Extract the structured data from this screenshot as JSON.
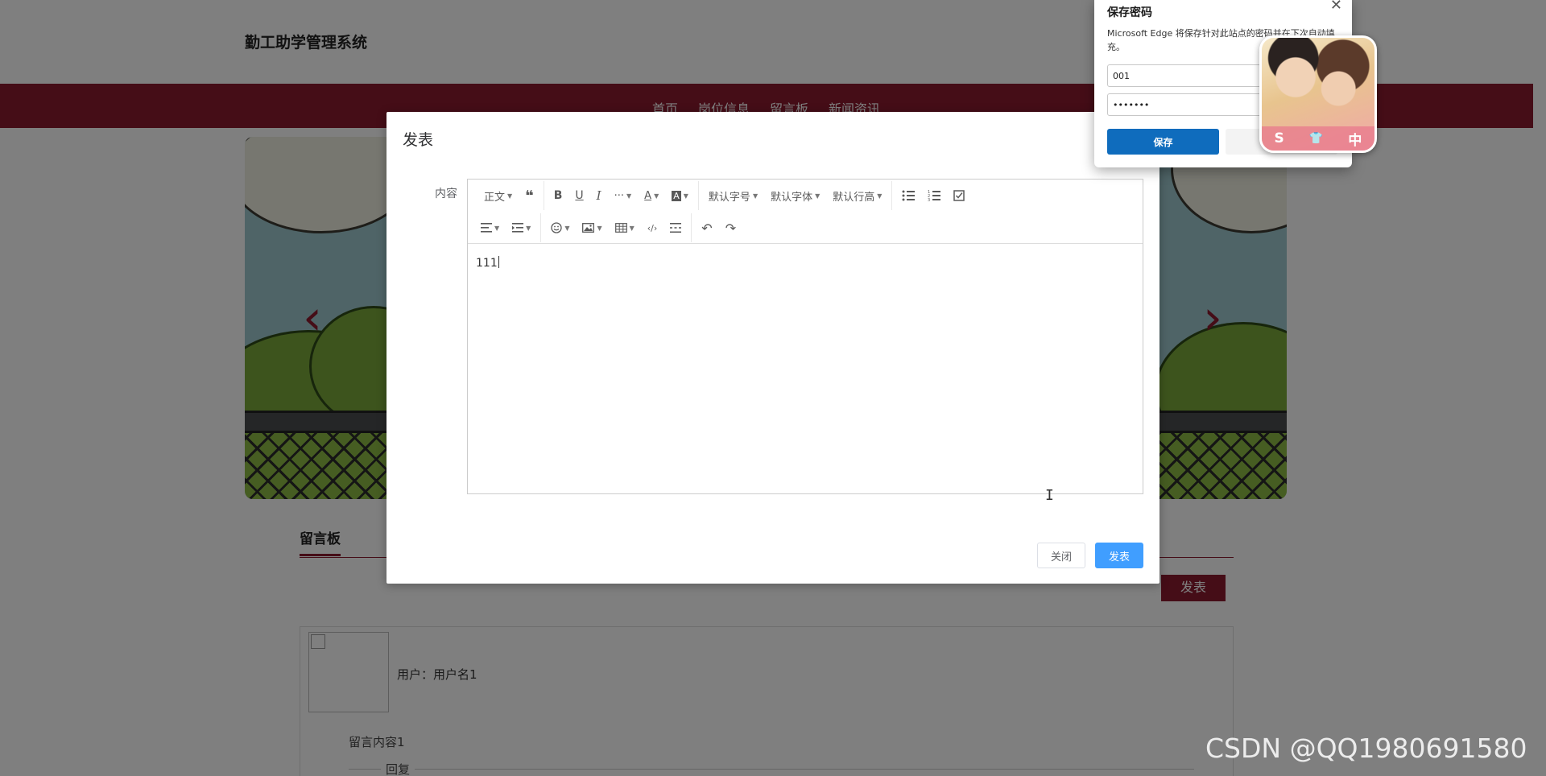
{
  "site": {
    "title": "勤工助学管理系统",
    "nav": [
      "首页",
      "岗位信息",
      "留言板",
      "新闻资讯"
    ]
  },
  "board": {
    "title": "留言板",
    "post_button": "发表",
    "message": {
      "user_line": "用户：用户名1",
      "content": "留言内容1",
      "reply": "回复"
    }
  },
  "dialog": {
    "title": "发表",
    "field_label": "内容",
    "toolbar": {
      "paragraph": "正文",
      "font_size": "默认字号",
      "font_family": "默认字体",
      "line_height": "默认行高"
    },
    "content_value": "111",
    "close_label": "关闭",
    "submit_label": "发表"
  },
  "password_popup": {
    "title": "保存密码",
    "description": "Microsoft Edge 将保存针对此站点的密码并在下次自动填充。",
    "username": "001",
    "password_mask": "•••••••",
    "save_label": "保存",
    "close_glyph": "✕"
  },
  "ime": {
    "icons": [
      "S",
      "👕",
      "中"
    ]
  },
  "watermark": "CSDN @QQ1980691580",
  "colors": {
    "brand": "#8b1a2e",
    "primary": "#409eff",
    "edge_blue": "#0f6cbd"
  }
}
